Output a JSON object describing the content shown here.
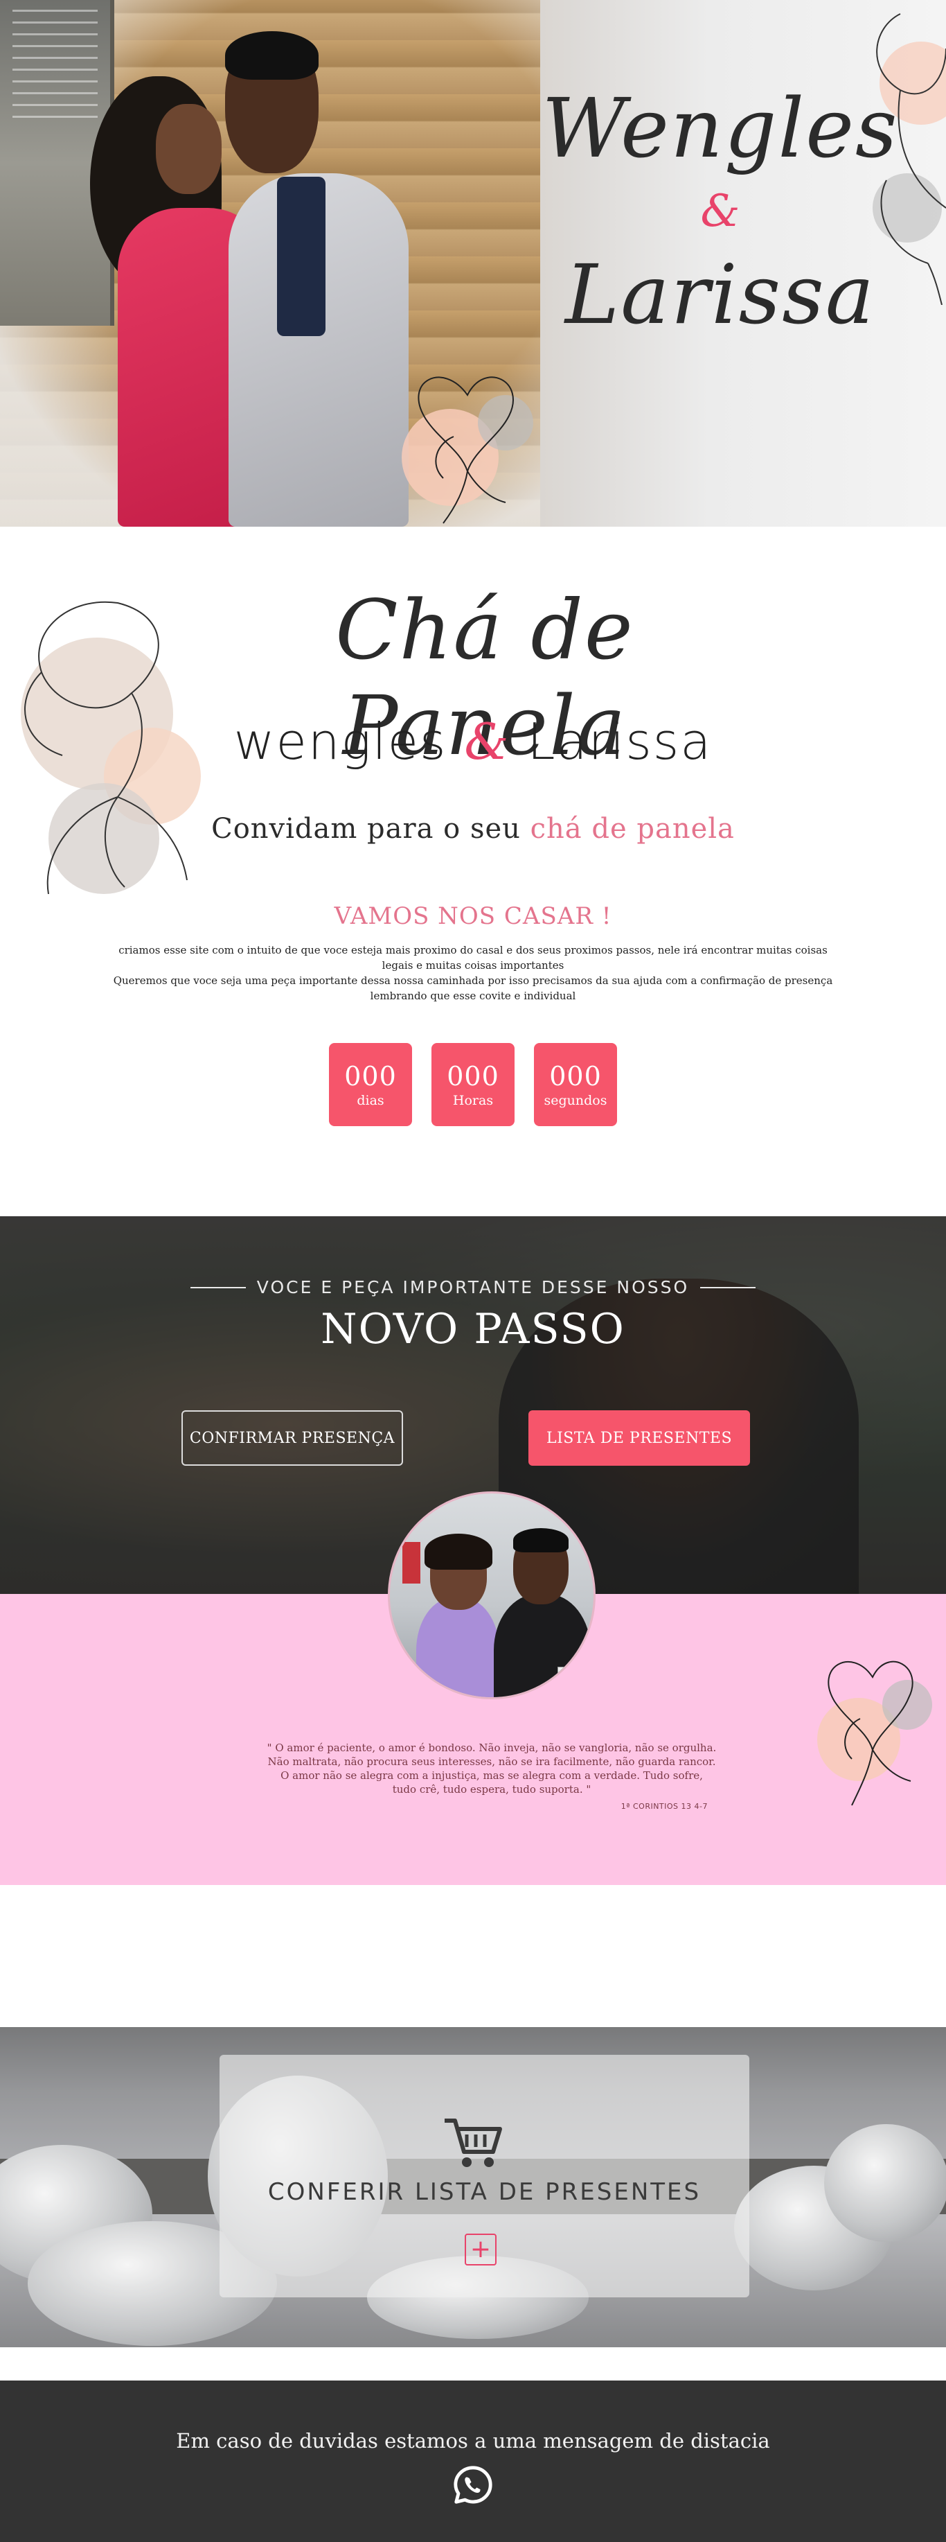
{
  "hero": {
    "name_1": "Wengles",
    "ampersand": "&",
    "name_2": "Larissa"
  },
  "invite": {
    "script_title": "Chá de Panela",
    "names_left": "wengles",
    "names_amp": "&",
    "names_right": "Larissa",
    "line_prefix": "Convidam para o seu ",
    "line_accent": "chá de panela",
    "headline": "VAMOS NOS CASAR !",
    "text_1": "criamos esse site com o intuito de que voce esteja mais proximo do casal e dos seus proximos passos, nele irá encontrar muitas coisas",
    "text_2": "legais e muitas coisas importantes",
    "text_3": "Queremos que voce seja uma peça importante dessa nossa caminhada por isso precisamos da sua ajuda com a confirmação de presença",
    "text_4": "lembrando que esse covite e individual"
  },
  "countdown": [
    {
      "value": "000",
      "label": "dias"
    },
    {
      "value": "000",
      "label": "Horas"
    },
    {
      "value": "000",
      "label": "segundos"
    }
  ],
  "passo": {
    "subtitle": "VOCE E  PEÇA IMPORTANTE DESSE NOSSO",
    "title": "NOVO PASSO",
    "confirm_button": "CONFIRMAR PRESENÇA",
    "gifts_button": "LISTA DE PRESENTES"
  },
  "quote": {
    "line_1": "\" O amor é paciente, o amor é bondoso. Não inveja, não se vangloria, não se orgulha.",
    "line_2": "Não maltrata, não procura seus interesses, não se ira facilmente, não guarda rancor.",
    "line_3": "O amor não se alegra com a injustiça, mas se alegra com a verdade. Tudo sofre,",
    "line_4": "tudo crê, tudo espera, tudo suporta. \"",
    "reference": "1ª CORINTIOS 13 4-7"
  },
  "gifts": {
    "label": "CONFERIR LISTA DE PRESENTES",
    "plus": "+",
    "icon": "cart-icon"
  },
  "footer": {
    "text": "Em caso de duvidas estamos a uma mensagem de distacia",
    "icon": "whatsapp-icon"
  },
  "colors": {
    "accent_pink": "#f6556b",
    "soft_pink": "#e4748d",
    "quote_bg": "#fec5e5",
    "footer_bg": "#333333"
  }
}
